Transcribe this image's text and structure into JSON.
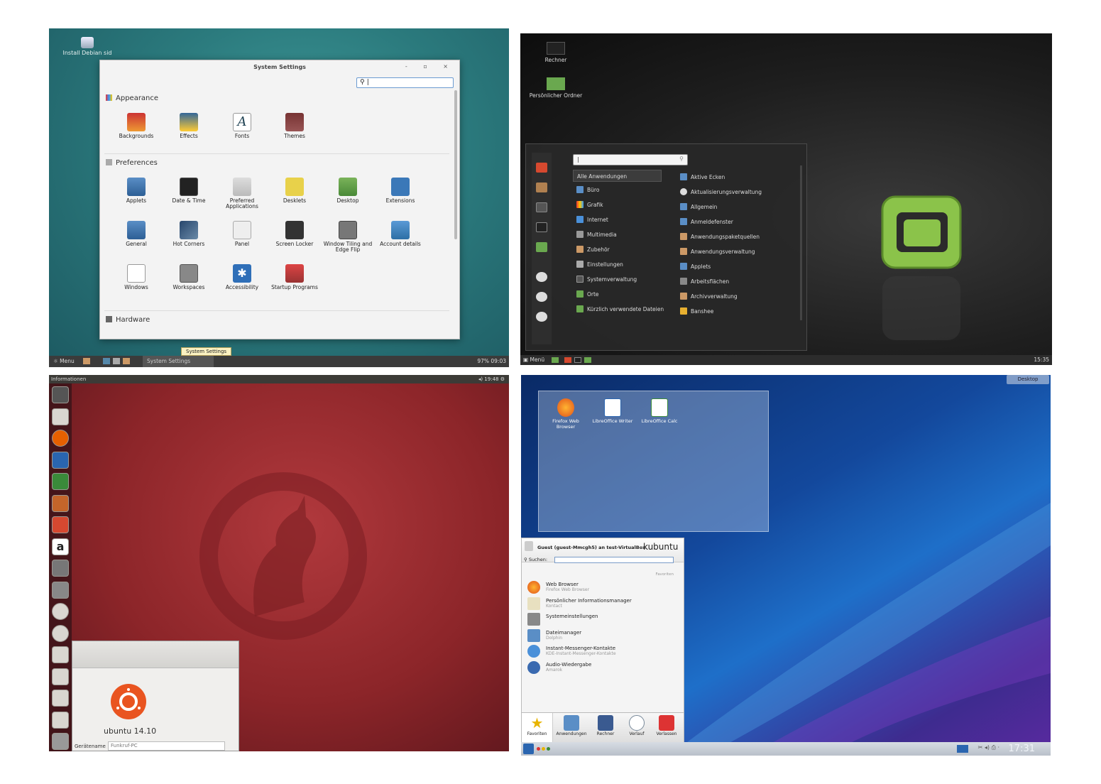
{
  "q1": {
    "desktop_icon_label": "Install Debian sid",
    "window_title": "System Settings",
    "window_buttons": "-  ▫  ×",
    "search_value": "|",
    "sections": {
      "appearance": "Appearance",
      "preferences": "Preferences",
      "hardware": "Hardware"
    },
    "appearance_items": [
      "Backgrounds",
      "Effects",
      "Fonts",
      "Themes"
    ],
    "pref_row1": [
      "Applets",
      "Date & Time",
      "Preferred Applications",
      "Desklets",
      "Desktop",
      "Extensions"
    ],
    "pref_row2": [
      "General",
      "Hot Corners",
      "Panel",
      "Screen Locker",
      "Window Tiling and Edge Flip",
      "Account details"
    ],
    "pref_row3": [
      "Windows",
      "Workspaces",
      "Accessibility",
      "Startup Programs"
    ],
    "tooltip": "System Settings",
    "panel": {
      "menu_label": "Menu",
      "task_label": "System Settings",
      "status": "97%  09:03"
    },
    "colors": {
      "accent": "#2b7a7d",
      "panel": "#3b3b3b"
    }
  },
  "q2": {
    "desktop_icons": [
      "Rechner",
      "Persönlicher Ordner"
    ],
    "search_value": "|",
    "categories": [
      "Alle Anwendungen",
      "Büro",
      "Grafik",
      "Internet",
      "Multimedia",
      "Zubehör",
      "Einstellungen",
      "Systemverwaltung",
      "Orte",
      "Kürzlich verwendete Dateien"
    ],
    "apps": [
      "Aktive Ecken",
      "Aktualisierungsverwaltung",
      "Allgemein",
      "Anmeldefenster",
      "Anwendungspaketquellen",
      "Anwendungsverwaltung",
      "Applets",
      "Arbeitsflächen",
      "Archivverwaltung",
      "Banshee"
    ],
    "panel": {
      "menu_label": "Menü",
      "time": "15:35"
    },
    "colors": {
      "logo_green": "#8bc34a"
    }
  },
  "q3": {
    "top_title": "Informationen",
    "top_time": "19:48",
    "release_label": "ubuntu 14.10",
    "device_label": "Gerätename",
    "device_value": "Funkruf-PC",
    "colors": {
      "accent": "#e95420"
    }
  },
  "q4": {
    "desktop_button": "Desktop",
    "desktop_icons": [
      "Firefox Web Browser",
      "LibreOffice Writer",
      "LibreOffice Calc"
    ],
    "user_line": "Guest (guest-Mmcgh5) an test-VirtualBox",
    "brand": "kubuntu",
    "search_label": "Suchen:",
    "favorites_label": "Favoriten",
    "apps": [
      {
        "name": "Web Browser",
        "sub": "Firefox Web Browser"
      },
      {
        "name": "Persönlicher Informationsmanager",
        "sub": "Kontact"
      },
      {
        "name": "Systemeinstellungen",
        "sub": ""
      },
      {
        "name": "Dateimanager",
        "sub": "Dolphin"
      },
      {
        "name": "Instant-Messenger-Kontakte",
        "sub": "KDE-Instant-Messenger-Kontakte"
      },
      {
        "name": "Audio-Wiedergabe",
        "sub": "Amarok"
      }
    ],
    "tabs": [
      "Favoriten",
      "Anwendungen",
      "Rechner",
      "Verlauf",
      "Verlassen"
    ],
    "clock": "17:31"
  }
}
